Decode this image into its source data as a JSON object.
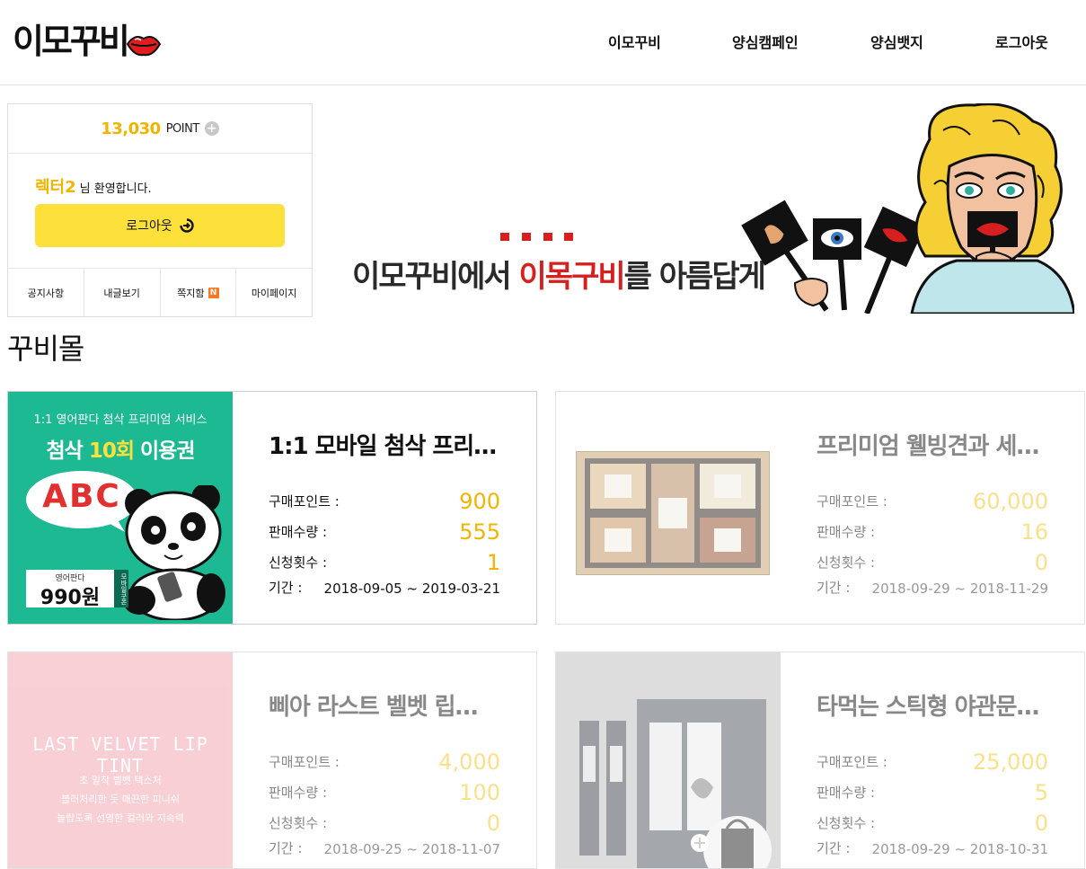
{
  "header": {
    "logo_text": "이모꾸비",
    "nav": [
      "이모꾸비",
      "양심캠페인",
      "양심뱃지",
      "로그아웃"
    ]
  },
  "user": {
    "points": "13,030",
    "points_unit": "POINT",
    "username": "렉터2",
    "welcome_suffix": "님 환영합니다.",
    "logout_label": "로그아웃",
    "menu": [
      "공지사항",
      "내글보기",
      "쪽지함",
      "마이페이지"
    ],
    "new_badge": "N"
  },
  "banner": {
    "text_prefix": "이모꾸비에서 ",
    "text_highlight": "이목구비",
    "text_suffix": "를 아름답게"
  },
  "section_title": "꾸비몰",
  "labels": {
    "purchase_point": "구매포인트 :",
    "sales_qty": "판매수량 :",
    "apply_count": "신청횟수 :",
    "period": "기간 :"
  },
  "products": [
    {
      "name": "1:1 모바일 첨삭 프리…",
      "purchase_point": "900",
      "sales_qty": "555",
      "apply_count": "1",
      "period": "2018-09-05 ~ 2019-03-21",
      "image": {
        "top_line": "1:1 영어판다 첨삭 프리미엄 서비스",
        "main_prefix": "첨삭 ",
        "main_highlight": "10회",
        "main_suffix": " 이용권",
        "bubble": "ABC",
        "price_label": "영어판다",
        "price": "990원",
        "side_tag": "모바일쿠폰"
      }
    },
    {
      "name": "프리미엄 웰빙견과 세…",
      "purchase_point": "60,000",
      "sales_qty": "16",
      "apply_count": "0",
      "period": "2018-09-29 ~ 2018-11-29"
    },
    {
      "name": "삐아 라스트 벨벳 립…",
      "purchase_point": "4,000",
      "sales_qty": "100",
      "apply_count": "0",
      "period": "2018-09-25 ~ 2018-11-07",
      "image": {
        "title": "LAST VELVET LIP TINT",
        "lines": [
          "초 밀착 벨벳 텍스처",
          "블러처리한 듯 매끈한 피니쉬",
          "놀랍도록 선명한 컬러와 지속력"
        ]
      }
    },
    {
      "name": "타먹는 스틱형 야관문…",
      "purchase_point": "25,000",
      "sales_qty": "5",
      "apply_count": "0",
      "period": "2018-09-29 ~ 2018-10-31"
    }
  ],
  "colors": {
    "accent": "#f3b400",
    "button": "#fde03a",
    "highlight_red": "#d62020",
    "panda_bg": "#1db993"
  }
}
